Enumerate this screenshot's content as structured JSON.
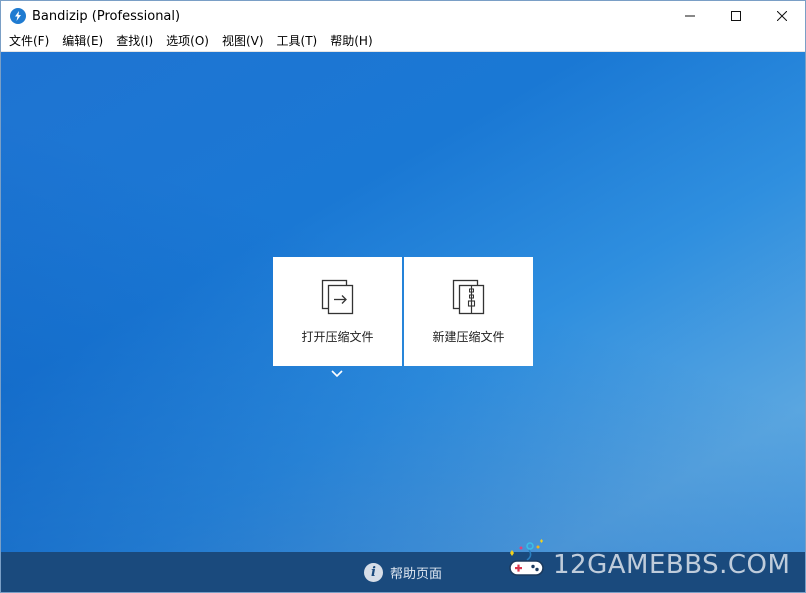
{
  "window": {
    "title": "Bandizip (Professional)",
    "controls": {
      "minimize": "—",
      "maximize": "☐",
      "close": "✕"
    }
  },
  "menu": {
    "items": [
      {
        "label": "文件(F)"
      },
      {
        "label": "编辑(E)"
      },
      {
        "label": "查找(I)"
      },
      {
        "label": "选项(O)"
      },
      {
        "label": "视图(V)"
      },
      {
        "label": "工具(T)"
      },
      {
        "label": "帮助(H)"
      }
    ]
  },
  "tiles": {
    "open_label": "打开压缩文件",
    "new_label": "新建压缩文件"
  },
  "footer": {
    "help_label": "帮助页面",
    "help_icon": "i"
  },
  "watermark": {
    "text": "12GAMEBBS.COM"
  },
  "colors": {
    "accent": "#1f7bd1",
    "footer_bg": "#1a4a7d",
    "main_bg": "#1f74d2"
  }
}
